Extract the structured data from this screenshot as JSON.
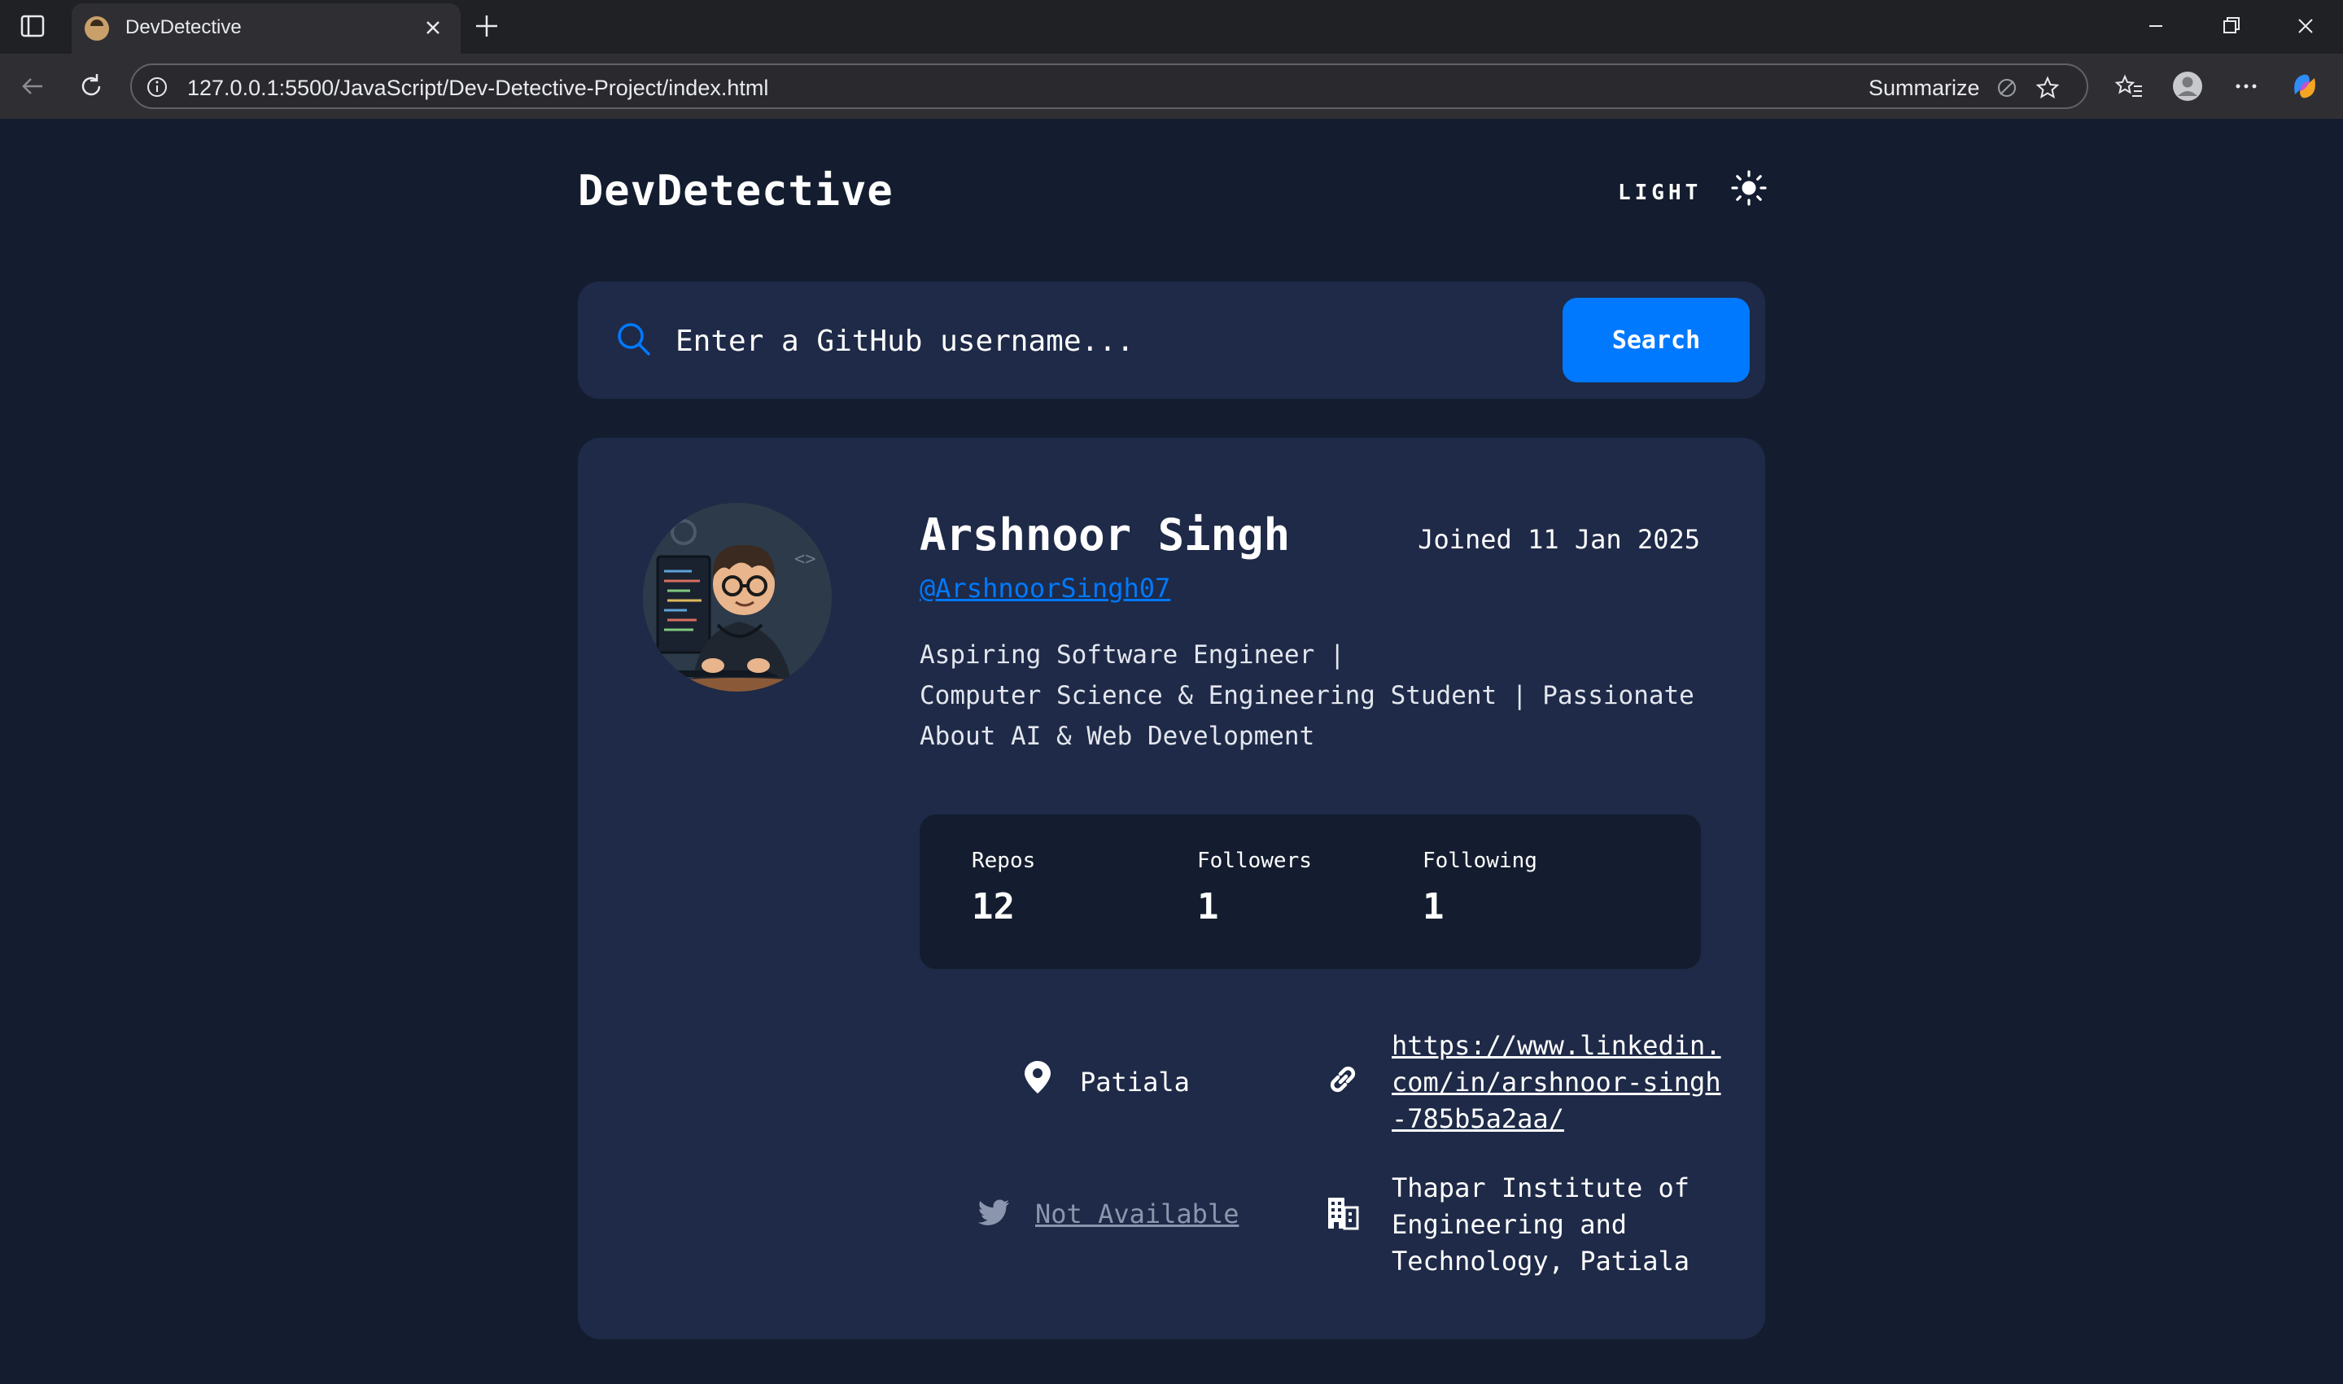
{
  "browser": {
    "tab_title": "DevDetective",
    "url": "127.0.0.1:5500/JavaScript/Dev-Detective-Project/index.html",
    "summarize_label": "Summarize"
  },
  "header": {
    "brand": "DevDetective",
    "theme_label": "LIGHT"
  },
  "search": {
    "placeholder": "Enter a GitHub username...",
    "button_label": "Search"
  },
  "profile": {
    "name": "Arshnoor Singh",
    "joined": "Joined 11 Jan 2025",
    "handle": "@ArshnoorSingh07",
    "bio_lines": [
      "Aspiring Software Engineer |",
      "Computer Science & Engineering Student | Passionate",
      "About AI & Web Development"
    ],
    "stats": {
      "repos_label": "Repos",
      "repos": "12",
      "followers_label": "Followers",
      "followers": "1",
      "following_label": "Following",
      "following": "1"
    },
    "location": "Patiala",
    "blog_lines": [
      "https://www.linkedin.",
      "com/in/arshnoor-singh",
      "-785b5a2aa/"
    ],
    "twitter": "Not Available",
    "company_lines": [
      "Thapar Institute of",
      "Engineering and",
      "Technology, Patiala"
    ]
  },
  "colors": {
    "accent": "#0079ff",
    "background": "#141d2f",
    "card": "#1e2a47"
  }
}
